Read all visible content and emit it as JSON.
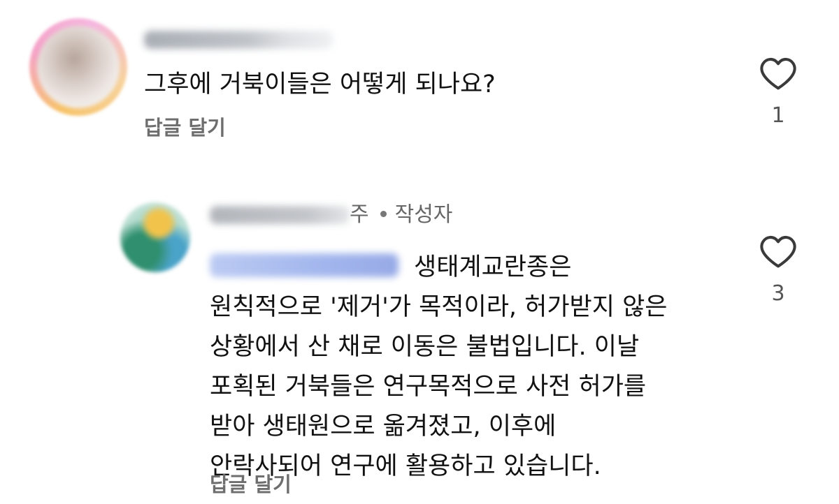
{
  "comments": [
    {
      "text": "그후에 거북이들은 어떻게 되나요?",
      "reply_label": "답글 달기",
      "likes": "1",
      "like_icon": "heart-outline-icon"
    }
  ],
  "reply": {
    "time": "주",
    "author_badge": "작성자",
    "lines": [
      "생태계교란종은",
      "원칙적으로 '제거'가 목적이라, 허가받지 않은",
      "상황에서 산 채로 이동은 불법입니다. 이날",
      "포획된 거북들은 연구목적으로 사전 허가를",
      "받아 생태원으로 옮겨졌고, 이후에",
      "안락사되어 연구에 활용하고 있습니다."
    ],
    "reply_label": "답글 달기",
    "likes": "3",
    "like_icon": "heart-outline-icon"
  },
  "colors": {
    "text": "#111111",
    "muted": "#6e6e6e",
    "mention": "#7c98e6"
  }
}
